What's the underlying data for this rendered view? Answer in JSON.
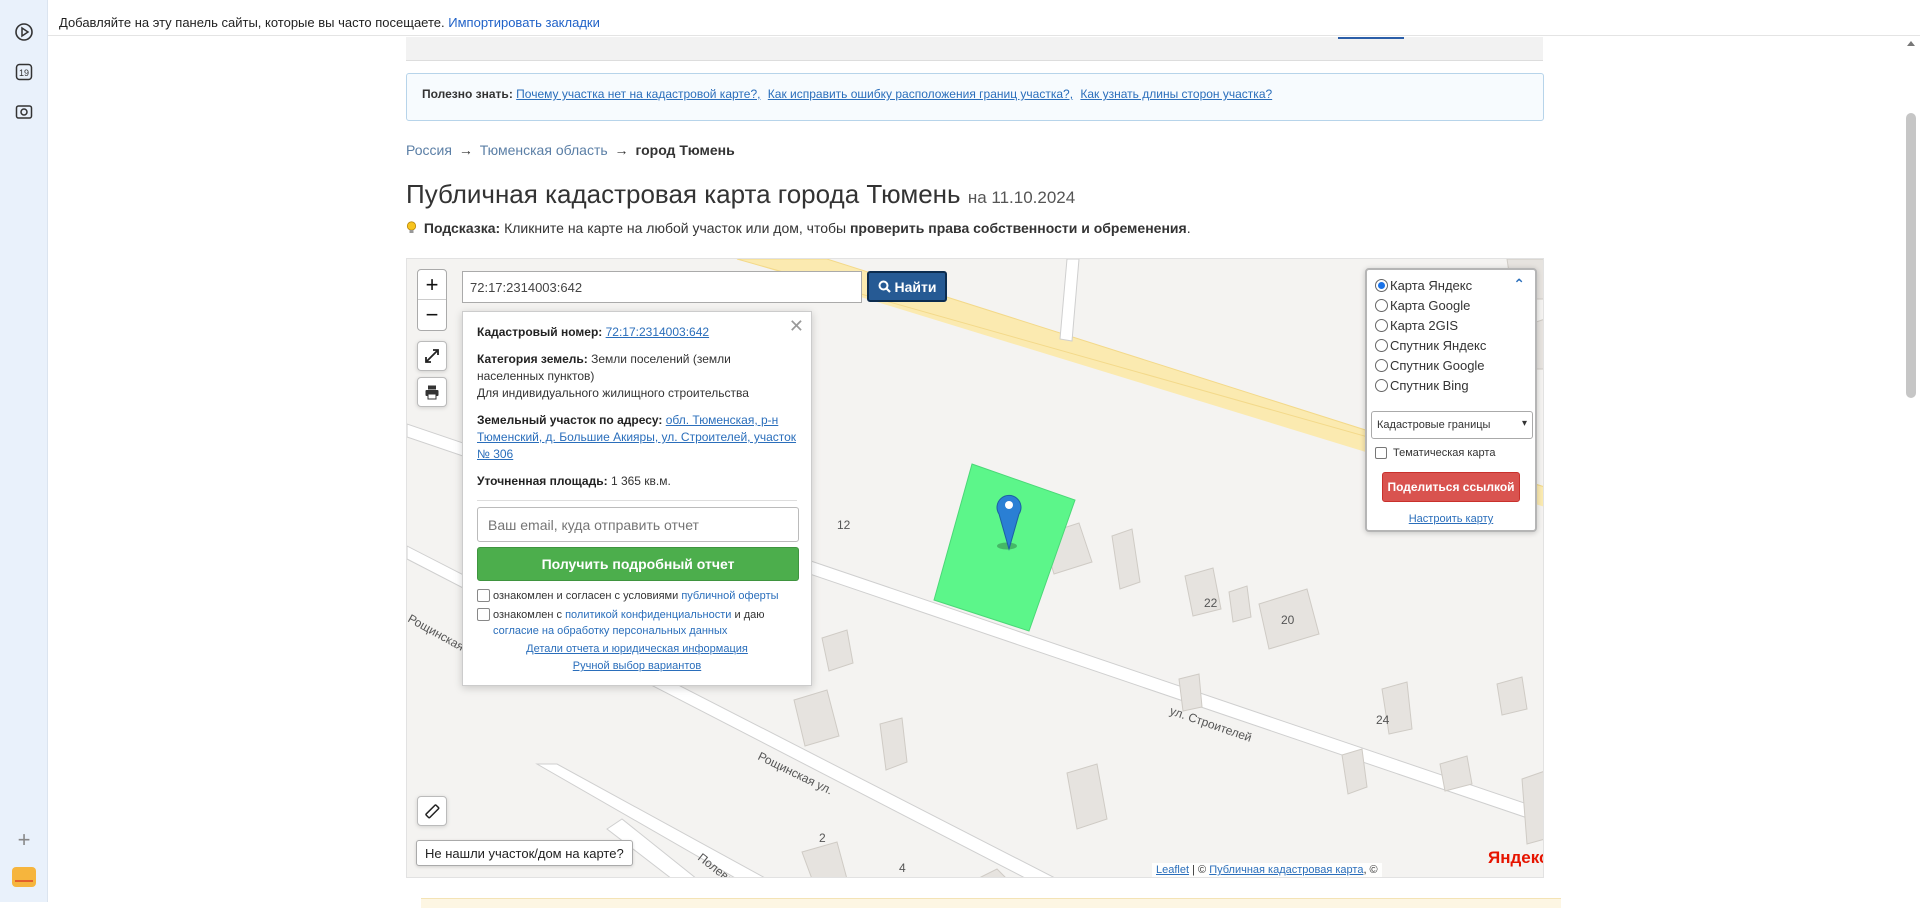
{
  "browser": {
    "bookmarks_tip": "Добавляйте на эту панель сайты, которые вы часто посещаете.",
    "import_link": "Импортировать закладки",
    "sidebar": {
      "calendar_day": "19",
      "icons": [
        "play-circle-icon",
        "calendar-icon",
        "camera-icon",
        "plus-icon",
        "mail-icon"
      ]
    }
  },
  "info_box": {
    "label": "Полезно знать:",
    "links": [
      "Почему участка нет на кадастровой карте?,",
      "Как исправить ошибку расположения границ участка?,",
      "Как узнать длины сторон участка?"
    ]
  },
  "breadcrumb": {
    "items": [
      "Россия",
      "Тюменская область"
    ],
    "separator": "→",
    "current": "город Тюмень"
  },
  "title": {
    "main": "Публичная кадастровая карта города Тюмень",
    "date": "на 11.10.2024"
  },
  "hint": {
    "label": "Подсказка:",
    "text": "Кликните на карте на любой участок или дом, чтобы",
    "bold": "проверить права собственности и обременения",
    "end": "."
  },
  "map": {
    "zoom_in": "+",
    "zoom_out": "−",
    "search_value": "72:17:2314003:642",
    "find_label": "Найти",
    "not_found_button": "Не нашли участок/дом на карте?",
    "street_labels": [
      "ул. Строителей",
      "Рощинская ул.",
      "Рощинская ул.",
      "Полево..."
    ],
    "house_numbers": [
      "12",
      "22",
      "20",
      "24",
      "2",
      "4"
    ],
    "parcel_color": "#5cf68a",
    "marker_color": "#2a7fd4",
    "yandex_logo": "Яндекс",
    "attribution": {
      "leaflet": "Leaflet",
      "sep": "| ©",
      "pkk": "Публичная кадастровая карта",
      "copy": ", ©"
    }
  },
  "popup": {
    "cadastral_label": "Кадастровый номер:",
    "cadastral_value": "72:17:2314003:642",
    "category_label": "Категория земель:",
    "category_value": "Земли поселений (земли населенных пунктов)",
    "usage": "Для индивидуального жилищного строительства",
    "address_label": "Земельный участок по адресу:",
    "address_value": "обл. Тюменская, р-н Тюменский, д. Большие Акияры, ул. Строителей, участок № 306",
    "area_label": "Уточненная площадь:",
    "area_value": "1 365 кв.м.",
    "email_placeholder": "Ваш email, куда отправить отчет",
    "report_button": "Получить подробный отчет",
    "check1_text": "ознакомлен и согласен с условиями",
    "check1_link": "публичной оферты",
    "check2_text": "ознакомлен с",
    "check2_link": "политикой конфиденциальности",
    "check2_mid": "и даю",
    "check2_link2": "согласие на обработку персональных данных",
    "details_link": "Детали отчета и юридическая информация",
    "manual_link": "Ручной выбор вариантов"
  },
  "layers": {
    "options": [
      {
        "label": "Карта Яндекс",
        "selected": true
      },
      {
        "label": "Карта Google",
        "selected": false
      },
      {
        "label": "Карта 2GIS",
        "selected": false
      },
      {
        "label": "Спутник Яндекс",
        "selected": false
      },
      {
        "label": "Спутник Google",
        "selected": false
      },
      {
        "label": "Спутник Bing",
        "selected": false
      }
    ],
    "select_value": "Кадастровые границы",
    "thematic_label": "Тематическая карта",
    "share_button": "Поделиться ссылкой",
    "config_link": "Настроить карту"
  }
}
